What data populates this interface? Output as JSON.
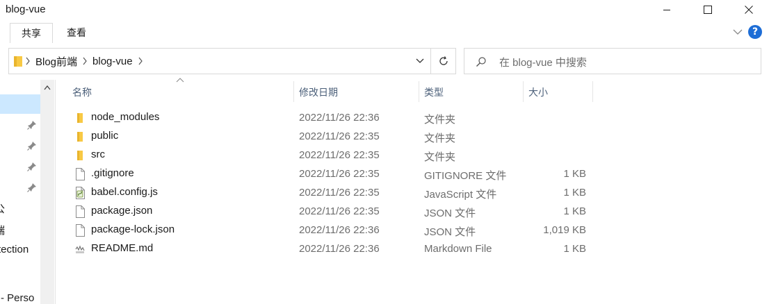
{
  "window": {
    "title": "blog-vue"
  },
  "ribbon": {
    "tabs": [
      {
        "label": "共享",
        "active": true
      },
      {
        "label": "查看",
        "active": false
      }
    ],
    "help_label": "?"
  },
  "address": {
    "breadcrumbs": [
      "Blog前端",
      "blog-vue"
    ]
  },
  "search": {
    "placeholder": "在 blog-vue 中搜索"
  },
  "nav": {
    "items": [
      "公",
      "端",
      "tection",
      "- Perso"
    ]
  },
  "columns": {
    "name": "名称",
    "date": "修改日期",
    "type": "类型",
    "size": "大小"
  },
  "files": [
    {
      "name": "node_modules",
      "date": "2022/11/26 22:36",
      "type": "文件夹",
      "size": "",
      "icon": "folder-icon"
    },
    {
      "name": "public",
      "date": "2022/11/26 22:35",
      "type": "文件夹",
      "size": "",
      "icon": "folder-icon"
    },
    {
      "name": "src",
      "date": "2022/11/26 22:35",
      "type": "文件夹",
      "size": "",
      "icon": "folder-icon"
    },
    {
      "name": ".gitignore",
      "date": "2022/11/26 22:35",
      "type": "GITIGNORE 文件",
      "size": "1 KB",
      "icon": "file-icon"
    },
    {
      "name": "babel.config.js",
      "date": "2022/11/26 22:35",
      "type": "JavaScript 文件",
      "size": "1 KB",
      "icon": "script-file-icon"
    },
    {
      "name": "package.json",
      "date": "2022/11/26 22:35",
      "type": "JSON 文件",
      "size": "1 KB",
      "icon": "file-icon"
    },
    {
      "name": "package-lock.json",
      "date": "2022/11/26 22:36",
      "type": "JSON 文件",
      "size": "1,019 KB",
      "icon": "file-icon"
    },
    {
      "name": "README.md",
      "date": "2022/11/26 22:36",
      "type": "Markdown File",
      "size": "1 KB",
      "icon": "markdown-file-icon"
    }
  ],
  "colors": {
    "folder": "#f8c944",
    "selection": "#cce8ff",
    "header_text": "#4c607a",
    "help_blue": "#1d6dd6"
  }
}
